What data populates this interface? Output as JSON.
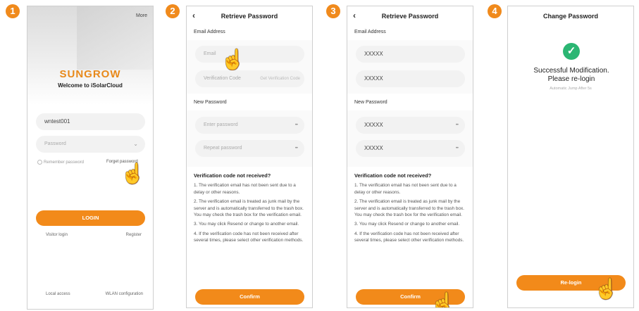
{
  "steps": [
    "1",
    "2",
    "3",
    "4"
  ],
  "screen1": {
    "more": "More",
    "brand": "SUNGROW",
    "welcome": "Welcome to iSolarCloud",
    "username": "wntest001",
    "password_placeholder": "Password",
    "remember": "Remember password",
    "forget": "Forget password",
    "login": "LOGIN",
    "visitor": "Visitor login",
    "register": "Register",
    "local_access": "Local access",
    "wlan": "WLAN configuration"
  },
  "screen2": {
    "title": "Retrieve Password",
    "email_label": "Email Address",
    "email_placeholder": "Email",
    "code_placeholder": "Verification Code",
    "get_code": "Get Verification Code",
    "new_password_label": "New Password",
    "enter_password": "Enter password",
    "repeat_password": "Repeat password",
    "confirm": "Confirm"
  },
  "screen3": {
    "title": "Retrieve Password",
    "email_label": "Email Address",
    "email_value": "XXXXX",
    "code_value": "XXXXX",
    "new_password_label": "New Password",
    "password_value": "XXXXX",
    "repeat_value": "XXXXX",
    "confirm": "Confirm"
  },
  "notes": {
    "heading": "Verification code not received?",
    "n1": "1. The verification email has not been sent due to a delay or other reasons.",
    "n2": "2. The verification email is treated as junk mail by the server and is automatically transferred to the trash box. You may check the trash box for the verification email.",
    "n3": "3. You may click Resend or change to another email.",
    "n4": "4. If the verification code has not been received after several times, please select other verification methods."
  },
  "screen4": {
    "title": "Change Password",
    "message": "Successful Modification. Please re-login",
    "auto_jump": "Automatic Jump After 5s",
    "relogin": "Re-login"
  },
  "colors": {
    "accent": "#f28a1a",
    "success": "#2bb673",
    "brand": "#e8891a"
  }
}
